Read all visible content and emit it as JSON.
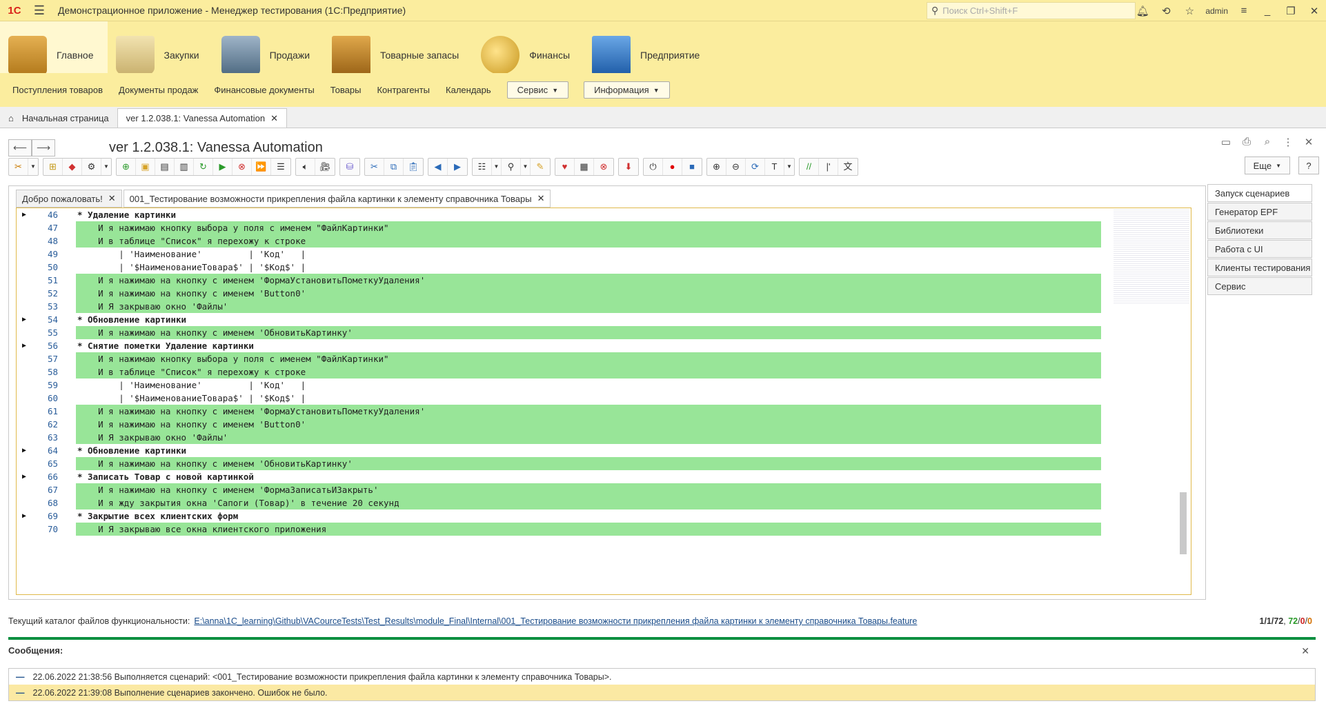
{
  "titlebar": {
    "logo": "1С",
    "title": "Демонстрационное приложение  - Менеджер тестирования (1С:Предприятие)",
    "search_placeholder": "Поиск Ctrl+Shift+F",
    "user": "admin"
  },
  "sections": [
    {
      "label": "Главное"
    },
    {
      "label": "Закупки"
    },
    {
      "label": "Продажи"
    },
    {
      "label": "Товарные запасы"
    },
    {
      "label": "Финансы"
    },
    {
      "label": "Предприятие"
    }
  ],
  "nav": {
    "links": [
      "Поступления товаров",
      "Документы продаж",
      "Финансовые документы",
      "Товары",
      "Контрагенты",
      "Календарь"
    ],
    "service": "Сервис",
    "info": "Информация"
  },
  "open_tabs": {
    "home": "Начальная страница",
    "current": "ver 1.2.038.1: Vanessa Automation"
  },
  "form": {
    "title": "ver 1.2.038.1: Vanessa Automation",
    "more": "Еще",
    "help": "?"
  },
  "editor": {
    "tab_welcome": "Добро пожаловать!",
    "tab_feature": "001_Тестирование возможности прикрепления файла картинки к элементу справочника Товары",
    "lines": [
      {
        "n": "46",
        "t": "* Удаление картинки"
      },
      {
        "n": "47",
        "t": "    И я нажимаю кнопку выбора у поля с именем \"ФайлКартинки\""
      },
      {
        "n": "48",
        "t": "    И в таблице \"Список\" я перехожу к строке"
      },
      {
        "n": "49",
        "t": "        | 'Наименование'         | 'Код'   |"
      },
      {
        "n": "50",
        "t": "        | '$НаименованиеТовара$' | '$Код$' |"
      },
      {
        "n": "51",
        "t": "    И я нажимаю на кнопку с именем 'ФормаУстановитьПометкуУдаления'"
      },
      {
        "n": "52",
        "t": "    И я нажимаю на кнопку с именем 'Button0'"
      },
      {
        "n": "53",
        "t": "    И Я закрываю окно 'Файлы'"
      },
      {
        "n": "54",
        "t": "* Обновление картинки"
      },
      {
        "n": "55",
        "t": "    И я нажимаю на кнопку с именем 'ОбновитьКартинку'"
      },
      {
        "n": "56",
        "t": "* Снятие пометки Удаление картинки"
      },
      {
        "n": "57",
        "t": "    И я нажимаю кнопку выбора у поля с именем \"ФайлКартинки\""
      },
      {
        "n": "58",
        "t": "    И в таблице \"Список\" я перехожу к строке"
      },
      {
        "n": "59",
        "t": "        | 'Наименование'         | 'Код'   |"
      },
      {
        "n": "60",
        "t": "        | '$НаименованиеТовара$' | '$Код$' |"
      },
      {
        "n": "61",
        "t": "    И я нажимаю на кнопку с именем 'ФормаУстановитьПометкуУдаления'"
      },
      {
        "n": "62",
        "t": "    И я нажимаю на кнопку с именем 'Button0'"
      },
      {
        "n": "63",
        "t": "    И Я закрываю окно 'Файлы'"
      },
      {
        "n": "64",
        "t": "* Обновление картинки"
      },
      {
        "n": "65",
        "t": "    И я нажимаю на кнопку с именем 'ОбновитьКартинку'"
      },
      {
        "n": "66",
        "t": "* Записать Товар с новой картинкой"
      },
      {
        "n": "67",
        "t": "    И я нажимаю на кнопку с именем 'ФормаЗаписатьИЗакрыть'"
      },
      {
        "n": "68",
        "t": "    И я жду закрытия окна 'Сапоги (Товар)' в течение 20 секунд"
      },
      {
        "n": "69",
        "t": "* Закрытие всех клиентских форм"
      },
      {
        "n": "70",
        "t": "    И Я закрываю все окна клиентского приложения"
      }
    ]
  },
  "right_panel": [
    "Запуск сценариев",
    "Генератор EPF",
    "Библиотеки",
    "Работа с UI",
    "Клиенты тестирования",
    "Сервис"
  ],
  "catalog": {
    "label": "Текущий каталог файлов функциональности:",
    "path": "E:\\anna\\1C_learning\\Github\\VACourceTests\\Test_Results\\module_Final\\Internal\\001_Тестирование возможности прикрепления файла картинки к элементу справочника Товары.feature",
    "count_a": "1/1/72",
    "count_b": "72",
    "count_c": "0",
    "count_d": "0"
  },
  "messages": {
    "title": "Сообщения:",
    "items": [
      "22.06.2022 21:38:56 Выполняется сценарий: <001_Тестирование возможности прикрепления файла картинки к элементу справочника Товары>.",
      "22.06.2022 21:39:08 Выполнение сценариев закончено. Ошибок не было."
    ]
  }
}
